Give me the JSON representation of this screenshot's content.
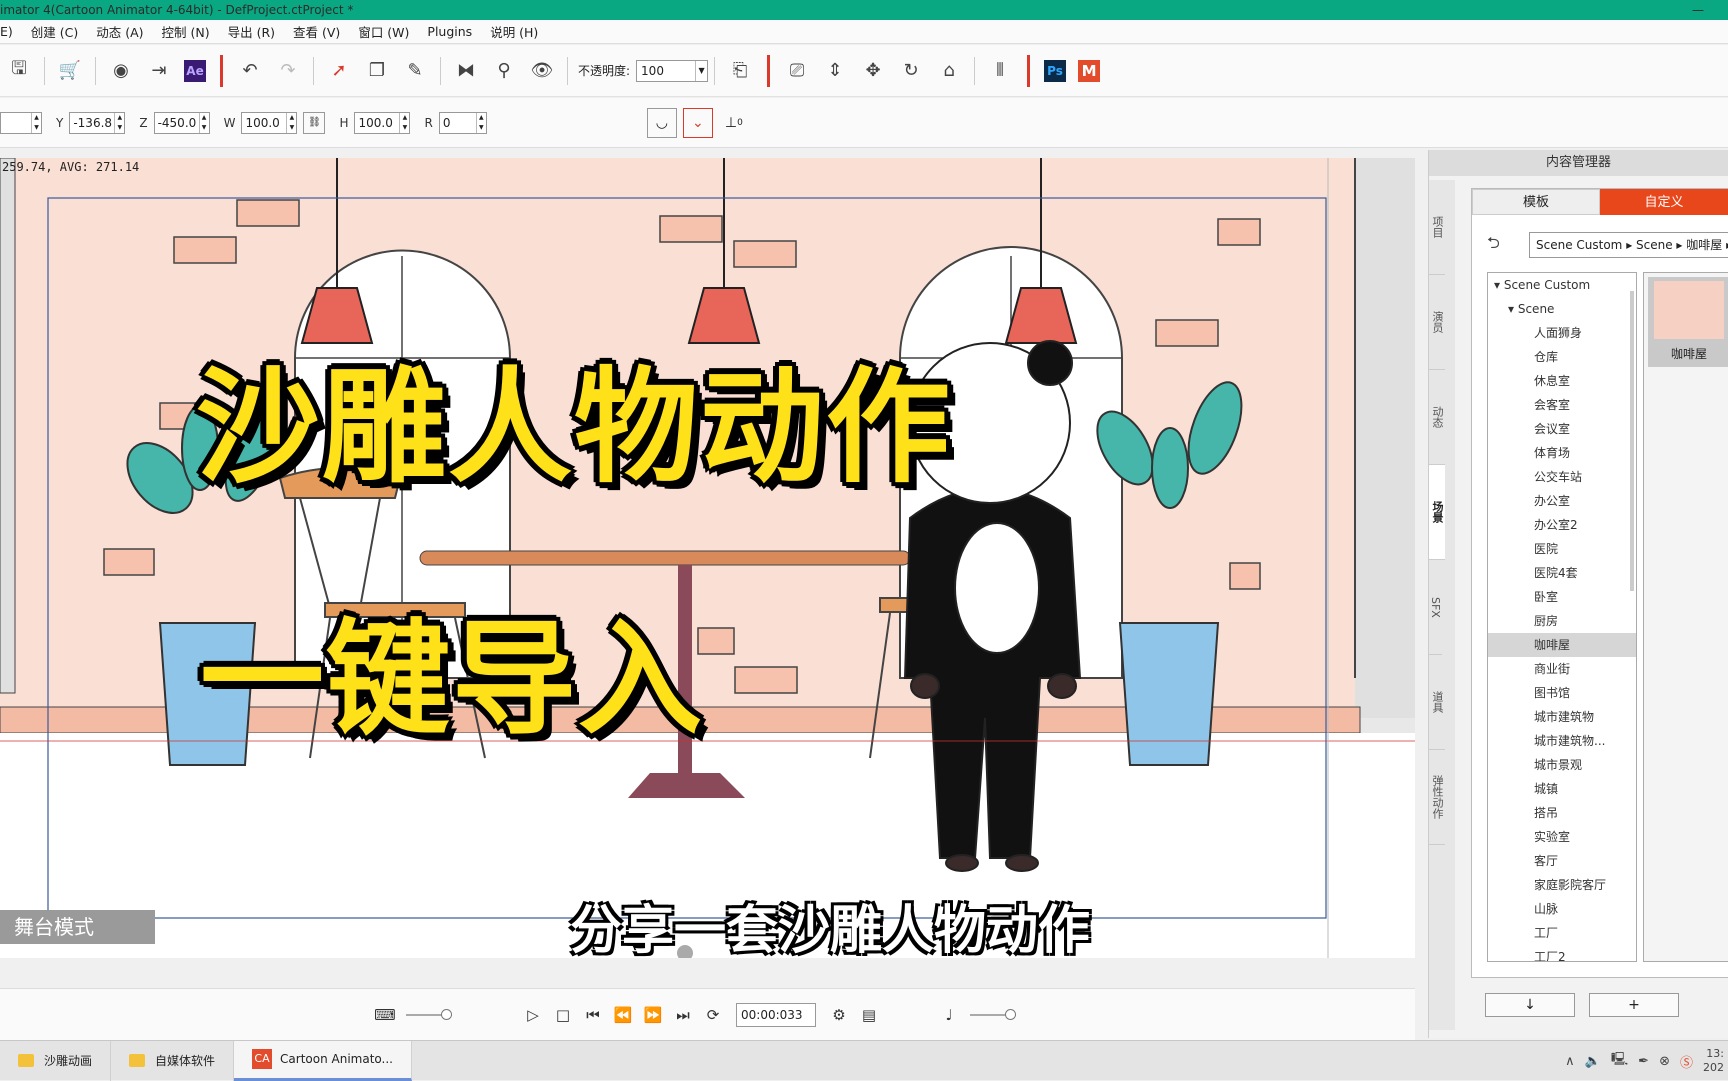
{
  "window": {
    "title": "imator 4(Cartoon Animator 4-64bit) - DefProject.ctProject *"
  },
  "menu": [
    "E)",
    "创建 (C)",
    "动态 (A)",
    "控制 (N)",
    "导出 (R)",
    "查看 (V)",
    "窗口 (W)",
    "Plugins",
    "说明 (H)"
  ],
  "toolbar": {
    "opacity_label": "不透明度:",
    "opacity_value": "100",
    "ae_label": "Ae",
    "ps_label": "Ps",
    "m_label": "M"
  },
  "props": {
    "y_label": "Y",
    "y_value": "-136.8",
    "z_label": "Z",
    "z_value": "-450.0",
    "w_label": "W",
    "w_value": "100.0",
    "h_label": "H",
    "h_value": "100.0",
    "r_label": "R",
    "r_value": "0",
    "pivot_value": "0"
  },
  "viewport": {
    "fps_text": "259.74, AVG: 271.14",
    "stage_mode": "舞台模式",
    "title_line1": "沙雕人物动作",
    "title_line2": "一键导入",
    "subtitle": "分享一套沙雕人物动作"
  },
  "playbar": {
    "time": "00:00:033"
  },
  "content_manager": {
    "header": "内容管理器",
    "tab_template": "模板",
    "tab_custom": "自定义",
    "breadcrumb": "Scene Custom ▸ Scene ▸ 咖啡屋 ▸",
    "side_tabs": [
      "项目",
      "演员",
      "动态",
      "场景",
      "SFX",
      "道具",
      "弹性动作"
    ],
    "tree_root": "Scene Custom",
    "tree_group": "Scene",
    "tree_items": [
      "人面狮身",
      "仓库",
      "休息室",
      "会客室",
      "会议室",
      "体育场",
      "公交车站",
      "办公室",
      "办公室2",
      "医院",
      "医院4套",
      "卧室",
      "厨房",
      "咖啡屋",
      "商业街",
      "图书馆",
      "城市建筑物",
      "城市建筑物...",
      "城市景观",
      "城镇",
      "搭吊",
      "实验室",
      "客厅",
      "家庭影院客厅",
      "山脉",
      "工厂",
      "工厂2"
    ],
    "selected_item": "咖啡屋",
    "thumbnail_label": "咖啡屋",
    "bottom_down": "↓",
    "bottom_add": "+"
  },
  "taskbar": {
    "items": [
      "沙雕动画",
      "自媒体软件",
      "Cartoon Animato..."
    ],
    "clock_time": "13:",
    "clock_date": "202"
  },
  "colors": {
    "accent": "#e8471c",
    "titlebar": "#0aa882",
    "title_yellow": "#ffe11a"
  }
}
